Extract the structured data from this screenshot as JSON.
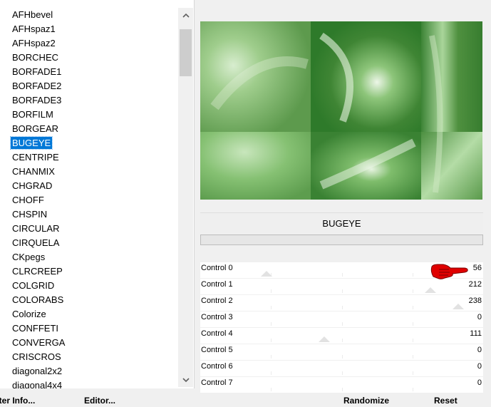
{
  "filter_list": {
    "items": [
      "AFHbevel",
      "AFHspaz1",
      "AFHspaz2",
      "BORCHEC",
      "BORFADE1",
      "BORFADE2",
      "BORFADE3",
      "BORFILM",
      "BORGEAR",
      "BUGEYE",
      "CENTRIPE",
      "CHANMIX",
      "CHGRAD",
      "CHOFF",
      "CHSPIN",
      "CIRCULAR",
      "CIRQUELA",
      "CKpegs",
      "CLRCREEP",
      "COLGRID",
      "COLORABS",
      "Colorize",
      "CONFFETI",
      "CONVERGA",
      "CRISCROS",
      "diagonal2x2",
      "diagonal4x4"
    ],
    "selected": "BUGEYE",
    "scroll_up_icon": "chevron-up-icon",
    "scroll_down_icon": "chevron-down-icon"
  },
  "filter_name": "BUGEYE",
  "controls": [
    {
      "label": "Control 0",
      "value": "56"
    },
    {
      "label": "Control 1",
      "value": "212"
    },
    {
      "label": "Control 2",
      "value": "238"
    },
    {
      "label": "Control 3",
      "value": "0"
    },
    {
      "label": "Control 4",
      "value": "111"
    },
    {
      "label": "Control 5",
      "value": "0"
    },
    {
      "label": "Control 6",
      "value": "0"
    },
    {
      "label": "Control 7",
      "value": "0"
    }
  ],
  "buttons": {
    "filter_info": "ilter Info...",
    "editor": "Editor...",
    "randomize": "Randomize",
    "reset": "Reset"
  },
  "colors": {
    "selection": "#0078d7",
    "pointer": "#e00000",
    "preview_green": "#5f9a4f"
  },
  "icons": {
    "pointer": "pointing-hand-icon"
  }
}
